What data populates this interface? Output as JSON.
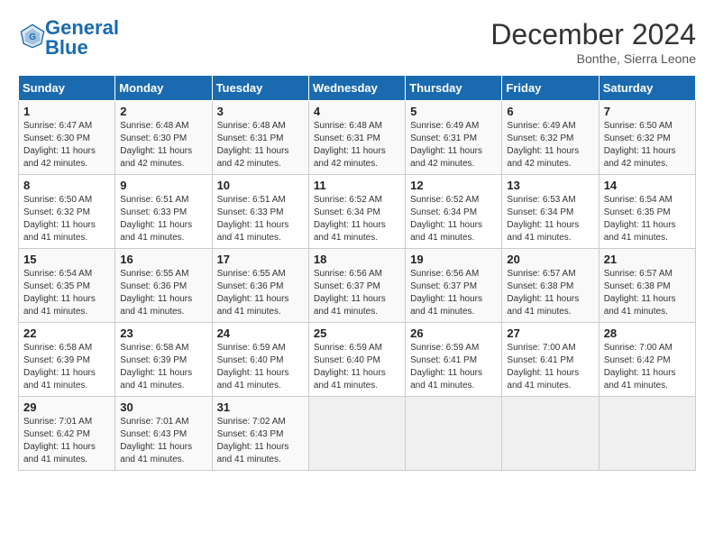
{
  "logo": {
    "line1": "General",
    "line2": "Blue"
  },
  "title": "December 2024",
  "subtitle": "Bonthe, Sierra Leone",
  "days_header": [
    "Sunday",
    "Monday",
    "Tuesday",
    "Wednesday",
    "Thursday",
    "Friday",
    "Saturday"
  ],
  "weeks": [
    [
      {
        "day": "1",
        "info": "Sunrise: 6:47 AM\nSunset: 6:30 PM\nDaylight: 11 hours\nand 42 minutes."
      },
      {
        "day": "2",
        "info": "Sunrise: 6:48 AM\nSunset: 6:30 PM\nDaylight: 11 hours\nand 42 minutes."
      },
      {
        "day": "3",
        "info": "Sunrise: 6:48 AM\nSunset: 6:31 PM\nDaylight: 11 hours\nand 42 minutes."
      },
      {
        "day": "4",
        "info": "Sunrise: 6:48 AM\nSunset: 6:31 PM\nDaylight: 11 hours\nand 42 minutes."
      },
      {
        "day": "5",
        "info": "Sunrise: 6:49 AM\nSunset: 6:31 PM\nDaylight: 11 hours\nand 42 minutes."
      },
      {
        "day": "6",
        "info": "Sunrise: 6:49 AM\nSunset: 6:32 PM\nDaylight: 11 hours\nand 42 minutes."
      },
      {
        "day": "7",
        "info": "Sunrise: 6:50 AM\nSunset: 6:32 PM\nDaylight: 11 hours\nand 42 minutes."
      }
    ],
    [
      {
        "day": "8",
        "info": "Sunrise: 6:50 AM\nSunset: 6:32 PM\nDaylight: 11 hours\nand 41 minutes."
      },
      {
        "day": "9",
        "info": "Sunrise: 6:51 AM\nSunset: 6:33 PM\nDaylight: 11 hours\nand 41 minutes."
      },
      {
        "day": "10",
        "info": "Sunrise: 6:51 AM\nSunset: 6:33 PM\nDaylight: 11 hours\nand 41 minutes."
      },
      {
        "day": "11",
        "info": "Sunrise: 6:52 AM\nSunset: 6:34 PM\nDaylight: 11 hours\nand 41 minutes."
      },
      {
        "day": "12",
        "info": "Sunrise: 6:52 AM\nSunset: 6:34 PM\nDaylight: 11 hours\nand 41 minutes."
      },
      {
        "day": "13",
        "info": "Sunrise: 6:53 AM\nSunset: 6:34 PM\nDaylight: 11 hours\nand 41 minutes."
      },
      {
        "day": "14",
        "info": "Sunrise: 6:54 AM\nSunset: 6:35 PM\nDaylight: 11 hours\nand 41 minutes."
      }
    ],
    [
      {
        "day": "15",
        "info": "Sunrise: 6:54 AM\nSunset: 6:35 PM\nDaylight: 11 hours\nand 41 minutes."
      },
      {
        "day": "16",
        "info": "Sunrise: 6:55 AM\nSunset: 6:36 PM\nDaylight: 11 hours\nand 41 minutes."
      },
      {
        "day": "17",
        "info": "Sunrise: 6:55 AM\nSunset: 6:36 PM\nDaylight: 11 hours\nand 41 minutes."
      },
      {
        "day": "18",
        "info": "Sunrise: 6:56 AM\nSunset: 6:37 PM\nDaylight: 11 hours\nand 41 minutes."
      },
      {
        "day": "19",
        "info": "Sunrise: 6:56 AM\nSunset: 6:37 PM\nDaylight: 11 hours\nand 41 minutes."
      },
      {
        "day": "20",
        "info": "Sunrise: 6:57 AM\nSunset: 6:38 PM\nDaylight: 11 hours\nand 41 minutes."
      },
      {
        "day": "21",
        "info": "Sunrise: 6:57 AM\nSunset: 6:38 PM\nDaylight: 11 hours\nand 41 minutes."
      }
    ],
    [
      {
        "day": "22",
        "info": "Sunrise: 6:58 AM\nSunset: 6:39 PM\nDaylight: 11 hours\nand 41 minutes."
      },
      {
        "day": "23",
        "info": "Sunrise: 6:58 AM\nSunset: 6:39 PM\nDaylight: 11 hours\nand 41 minutes."
      },
      {
        "day": "24",
        "info": "Sunrise: 6:59 AM\nSunset: 6:40 PM\nDaylight: 11 hours\nand 41 minutes."
      },
      {
        "day": "25",
        "info": "Sunrise: 6:59 AM\nSunset: 6:40 PM\nDaylight: 11 hours\nand 41 minutes."
      },
      {
        "day": "26",
        "info": "Sunrise: 6:59 AM\nSunset: 6:41 PM\nDaylight: 11 hours\nand 41 minutes."
      },
      {
        "day": "27",
        "info": "Sunrise: 7:00 AM\nSunset: 6:41 PM\nDaylight: 11 hours\nand 41 minutes."
      },
      {
        "day": "28",
        "info": "Sunrise: 7:00 AM\nSunset: 6:42 PM\nDaylight: 11 hours\nand 41 minutes."
      }
    ],
    [
      {
        "day": "29",
        "info": "Sunrise: 7:01 AM\nSunset: 6:42 PM\nDaylight: 11 hours\nand 41 minutes."
      },
      {
        "day": "30",
        "info": "Sunrise: 7:01 AM\nSunset: 6:43 PM\nDaylight: 11 hours\nand 41 minutes."
      },
      {
        "day": "31",
        "info": "Sunrise: 7:02 AM\nSunset: 6:43 PM\nDaylight: 11 hours\nand 41 minutes."
      },
      {
        "day": "",
        "info": ""
      },
      {
        "day": "",
        "info": ""
      },
      {
        "day": "",
        "info": ""
      },
      {
        "day": "",
        "info": ""
      }
    ]
  ]
}
